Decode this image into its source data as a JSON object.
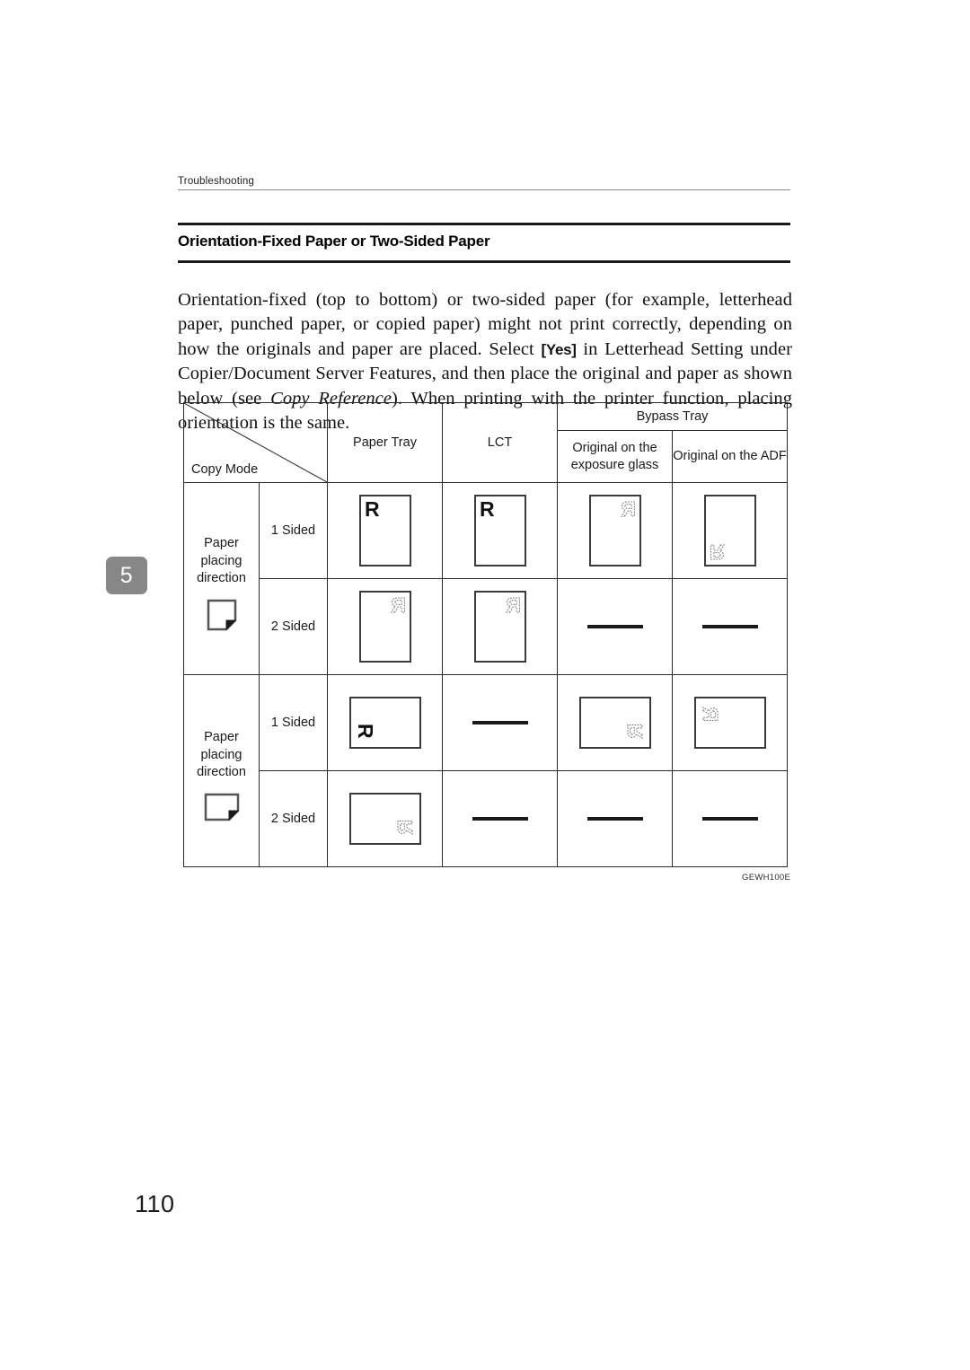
{
  "running_header": {
    "label": "Troubleshooting"
  },
  "chapter_tab": {
    "number": "5"
  },
  "section": {
    "heading": "Orientation-Fixed Paper or Two-Sided Paper"
  },
  "paragraph": {
    "part1": "Orientation-fixed (top to bottom) or two-sided paper (for example, letterhead paper, punched paper, or copied paper) might not print correctly, depending on how the originals and paper are placed. Select ",
    "keyword": "[Yes]",
    "part2": " in Letterhead Setting under Copier/Document Server Features, and then place the original and paper as shown below (see ",
    "italic": "Copy Reference",
    "part3": "). When printing with the printer function, placing orientation is the same."
  },
  "table": {
    "corner_label": "Copy Mode",
    "columns": {
      "paper_tray": "Paper Tray",
      "lct": "LCT",
      "bypass_tray": "Bypass Tray",
      "bypass_exposure_glass": "Original on the exposure glass",
      "bypass_adf": "Original on the ADF"
    },
    "row_groups": [
      {
        "label_line1": "Paper",
        "label_line2": "placing",
        "label_line3": "direction",
        "icon": "page-portrait-folded-corner-icon",
        "rows": [
          {
            "mode": "1 Sided",
            "cells": [
              {
                "kind": "sheet",
                "orientation": "portrait",
                "glyph": "R",
                "glyph_style": "solid",
                "corner": "top-left",
                "rotation": 0,
                "mirrored": false
              },
              {
                "kind": "sheet",
                "orientation": "portrait",
                "glyph": "R",
                "glyph_style": "solid",
                "corner": "top-left",
                "rotation": 0,
                "mirrored": false
              },
              {
                "kind": "sheet",
                "orientation": "portrait",
                "glyph": "R",
                "glyph_style": "dotted",
                "corner": "top-right",
                "rotation": 0,
                "mirrored": true
              },
              {
                "kind": "sheet",
                "orientation": "portrait",
                "glyph": "R",
                "glyph_style": "dotted",
                "corner": "bottom-left",
                "rotation": 180,
                "mirrored": true
              }
            ]
          },
          {
            "mode": "2 Sided",
            "cells": [
              {
                "kind": "sheet",
                "orientation": "portrait",
                "glyph": "R",
                "glyph_style": "dotted",
                "corner": "top-right",
                "rotation": 0,
                "mirrored": true
              },
              {
                "kind": "sheet",
                "orientation": "portrait",
                "glyph": "R",
                "glyph_style": "dotted",
                "corner": "top-right",
                "rotation": 0,
                "mirrored": true
              },
              {
                "kind": "dash"
              },
              {
                "kind": "dash"
              }
            ]
          }
        ]
      },
      {
        "label_line1": "Paper",
        "label_line2": "placing",
        "label_line3": "direction",
        "icon": "page-landscape-folded-corner-icon",
        "rows": [
          {
            "mode": "1 Sided",
            "cells": [
              {
                "kind": "sheet",
                "orientation": "landscape",
                "glyph": "R",
                "glyph_style": "solid",
                "corner": "bottom-left",
                "rotation": 90,
                "mirrored": false
              },
              {
                "kind": "dash"
              },
              {
                "kind": "sheet",
                "orientation": "landscape",
                "glyph": "R",
                "glyph_style": "dotted",
                "corner": "bottom-right",
                "rotation": 90,
                "mirrored": true
              },
              {
                "kind": "sheet",
                "orientation": "landscape",
                "glyph": "R",
                "glyph_style": "dotted",
                "corner": "top-left",
                "rotation": 270,
                "mirrored": true
              }
            ]
          },
          {
            "mode": "2 Sided",
            "cells": [
              {
                "kind": "sheet",
                "orientation": "landscape",
                "glyph": "R",
                "glyph_style": "dotted",
                "corner": "bottom-right",
                "rotation": 90,
                "mirrored": true
              },
              {
                "kind": "dash"
              },
              {
                "kind": "dash"
              },
              {
                "kind": "dash"
              }
            ]
          }
        ]
      }
    ]
  },
  "figure_code": "GEWH100E",
  "page_number": "110"
}
